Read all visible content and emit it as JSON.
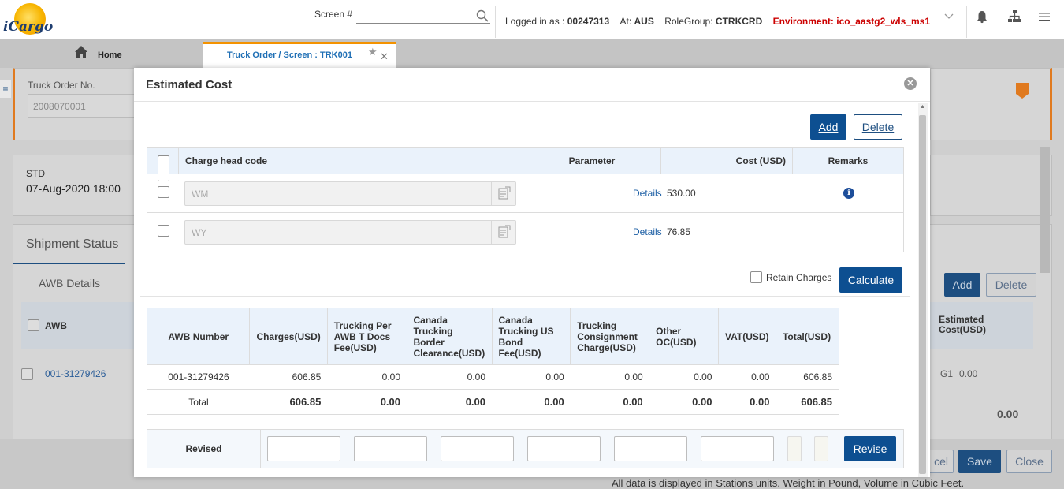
{
  "header": {
    "logo_text": "iCargo",
    "screen_label": "Screen #",
    "screen_value": "",
    "logged_in_label": "Logged in as :",
    "user_id": "00247313",
    "at_label": "At:",
    "station": "AUS",
    "rolegroup_label": "RoleGroup:",
    "rolegroup": "CTRKCRD",
    "environment": "Environment: ico_aastg2_wls_ms1"
  },
  "tabs": {
    "home_label": "Home",
    "active_tab_label": "Truck Order / Screen : TRK001"
  },
  "background": {
    "truck_order_label": "Truck Order No.",
    "truck_order_value": "2008070001",
    "std_label": "STD",
    "std_value": "07-Aug-2020 18:00",
    "shipment_status_tab": "Shipment Status",
    "awb_details_tab": "AWB Details",
    "awb_col": "AWB",
    "awb_value": "001-31279426",
    "estimated_cost_col": "Estimated Cost(USD)",
    "row_code": "G1",
    "row_cost": "0.00",
    "total_cost": "0.00",
    "add_label": "Add",
    "delete_label": "Delete",
    "cancel_label": "cel",
    "save_label": "Save",
    "close_label": "Close"
  },
  "modal": {
    "title": "Estimated Cost",
    "add_label": "Add",
    "delete_label": "Delete",
    "charges_grid": {
      "columns": [
        "Charge head code",
        "Parameter",
        "Cost (USD)",
        "Remarks"
      ],
      "rows": [
        {
          "code": "WM",
          "parameter": "Details",
          "cost": "530.00",
          "has_remark": true
        },
        {
          "code": "WY",
          "parameter": "Details",
          "cost": "76.85",
          "has_remark": false
        }
      ]
    },
    "retain_charges_label": "Retain Charges",
    "calculate_label": "Calculate",
    "summary_grid": {
      "columns": [
        "AWB Number",
        "Charges(USD)",
        "Trucking Per AWB T Docs Fee(USD)",
        "Canada Trucking Border Clearance(USD)",
        "Canada Trucking US Bond Fee(USD)",
        "Trucking Consignment Charge(USD)",
        "Other OC(USD)",
        "VAT(USD)",
        "Total(USD)"
      ],
      "row": [
        "001-31279426",
        "606.85",
        "0.00",
        "0.00",
        "0.00",
        "0.00",
        "0.00",
        "0.00",
        "606.85"
      ],
      "total": [
        "Total",
        "606.85",
        "0.00",
        "0.00",
        "0.00",
        "0.00",
        "0.00",
        "0.00",
        "606.85"
      ]
    },
    "revised_label": "Revised",
    "revise_label": "Revise"
  },
  "footer_note": "All data is displayed in Stations units. Weight in Pound, Volume in Cubic Feet."
}
